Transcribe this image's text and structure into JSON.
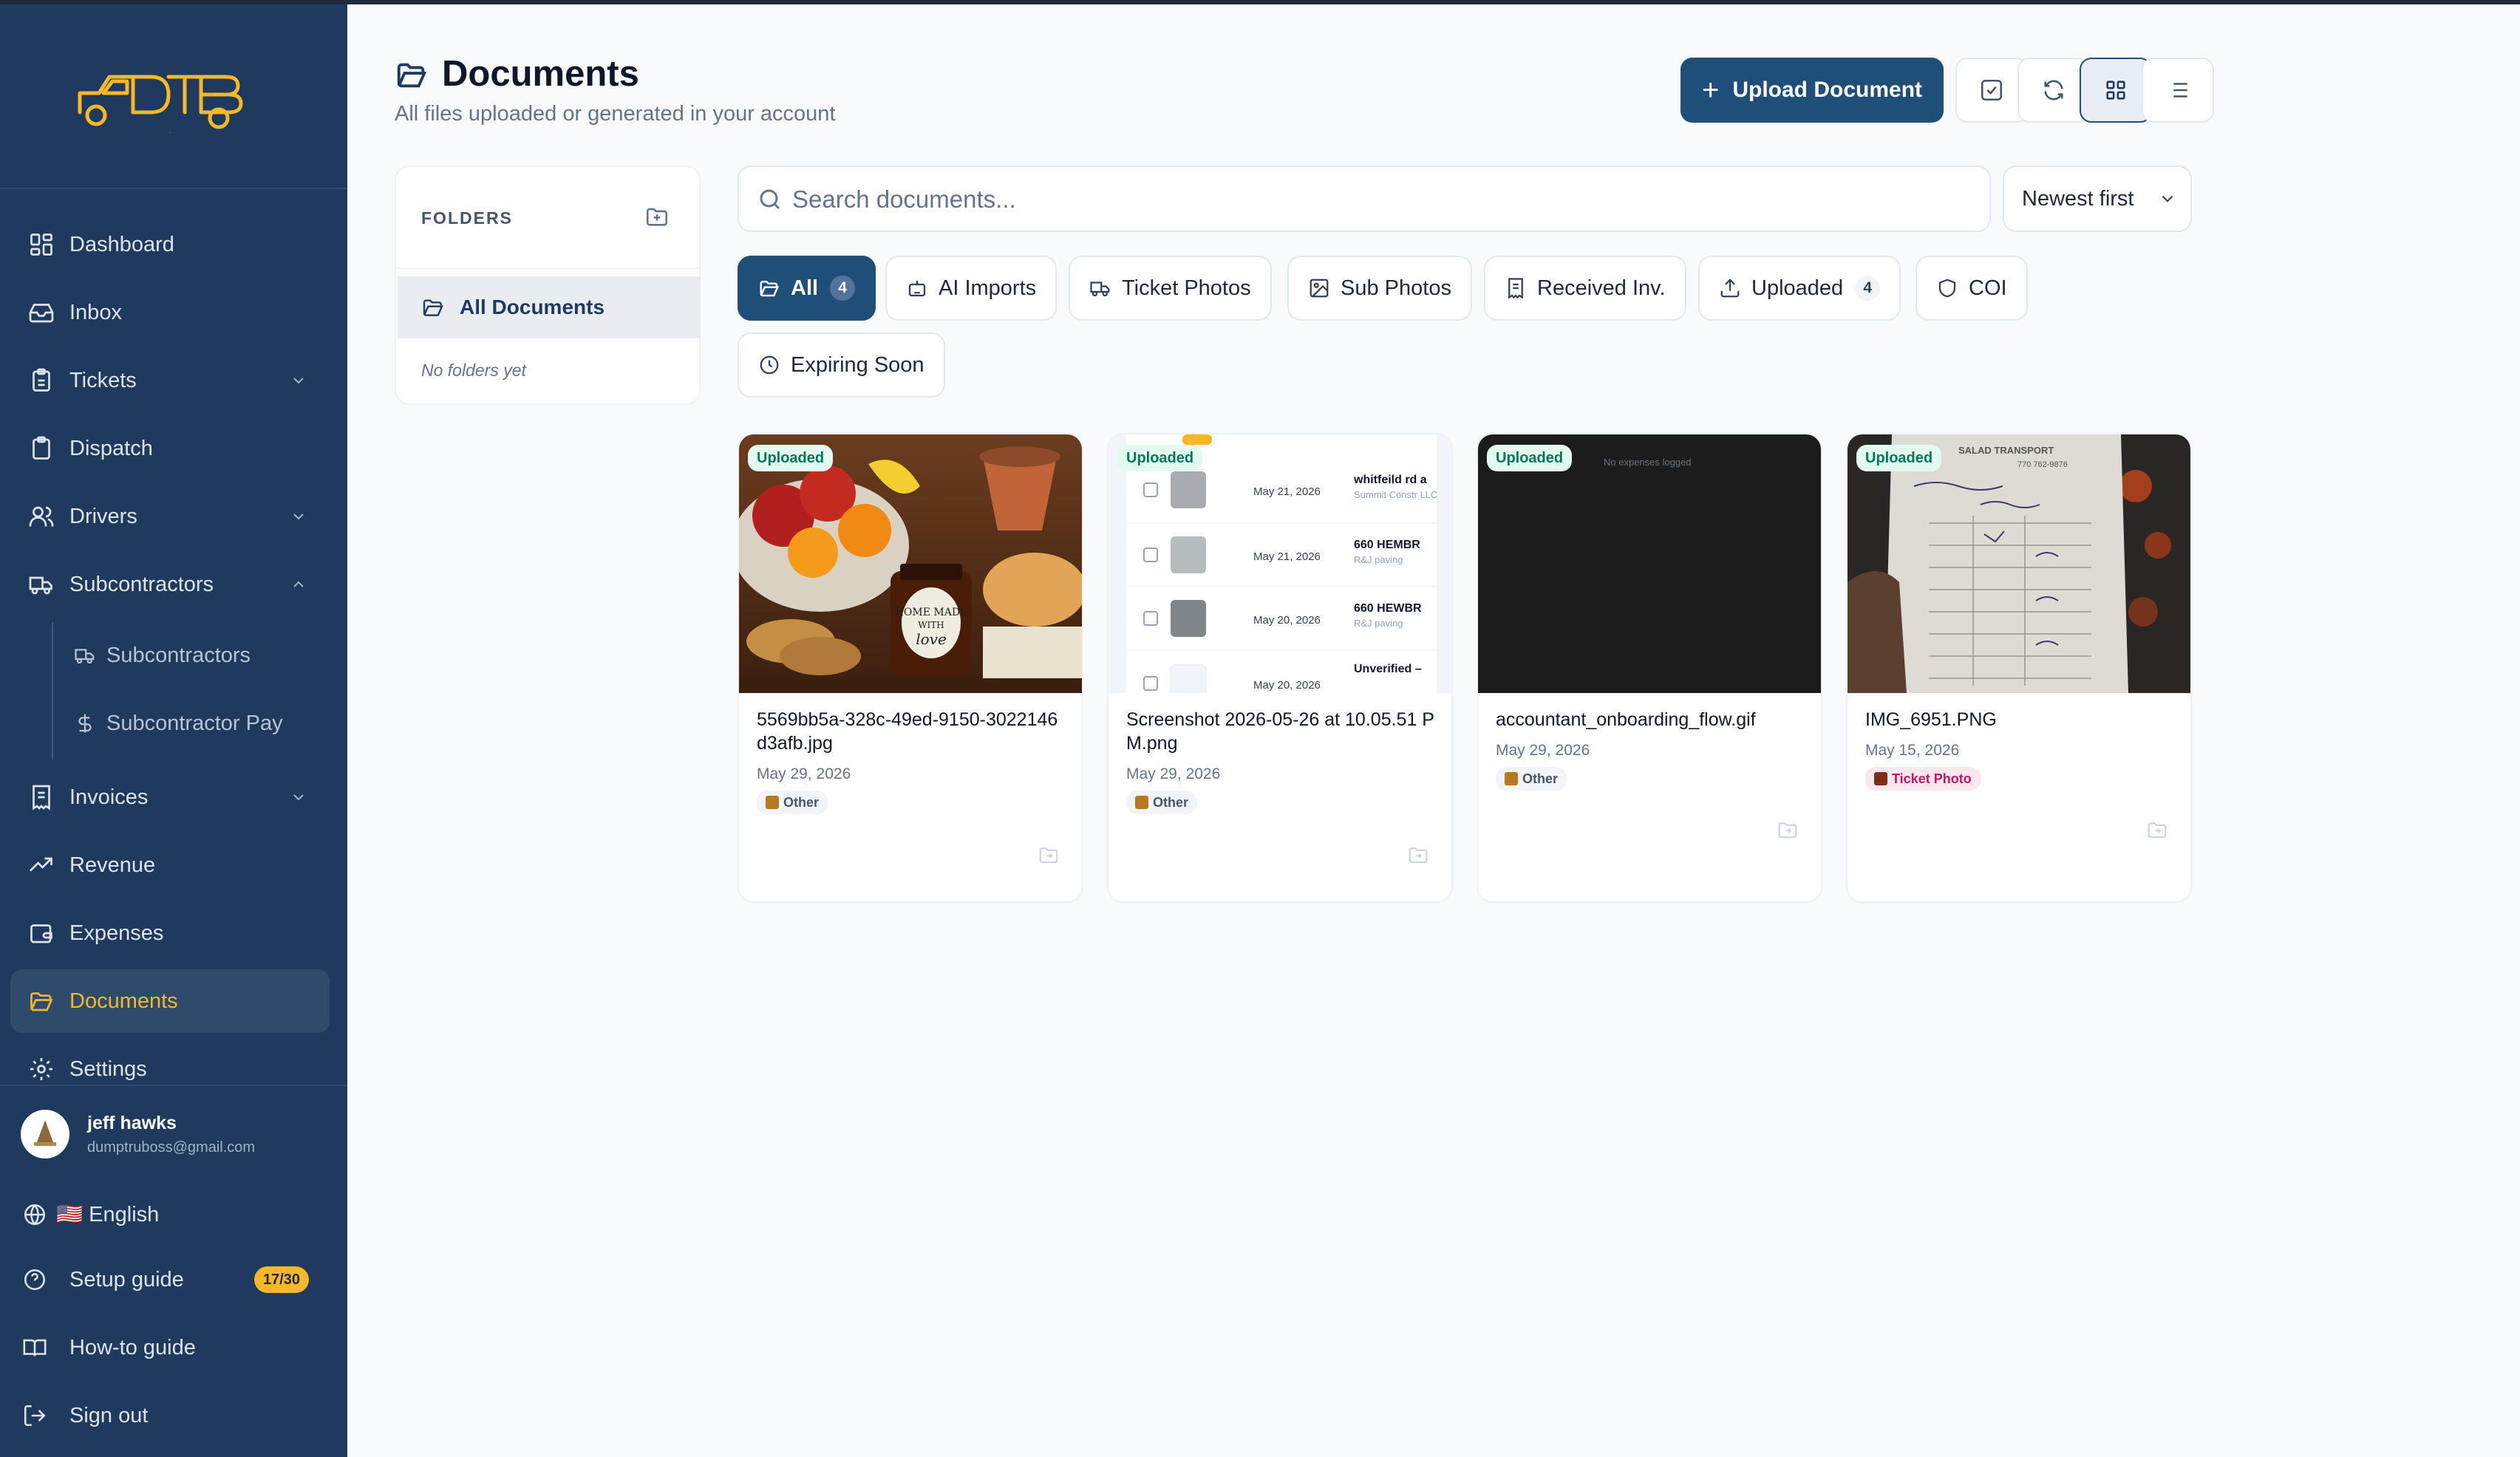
{
  "brand": {
    "logo_text": "DTB",
    "accent": "#f6b829",
    "primary": "#1f4e79",
    "sidebar_bg": "#1f3a5c"
  },
  "sidebar": {
    "items": [
      {
        "label": "Dashboard",
        "icon": "dashboard-icon"
      },
      {
        "label": "Inbox",
        "icon": "inbox-icon"
      },
      {
        "label": "Tickets",
        "icon": "clipboard-icon",
        "chevron": "down"
      },
      {
        "label": "Dispatch",
        "icon": "clipboard-icon"
      },
      {
        "label": "Drivers",
        "icon": "users-icon",
        "chevron": "down"
      },
      {
        "label": "Subcontractors",
        "icon": "truck-icon",
        "chevron": "up"
      },
      {
        "label": "Subcontractors",
        "icon": "truck-icon",
        "sub": true
      },
      {
        "label": "Subcontractor Pay",
        "icon": "dollar-icon",
        "sub": true
      },
      {
        "label": "Invoices",
        "icon": "receipt-icon",
        "chevron": "down"
      },
      {
        "label": "Revenue",
        "icon": "trend-up-icon"
      },
      {
        "label": "Expenses",
        "icon": "wallet-icon"
      },
      {
        "label": "Documents",
        "icon": "folder-open-icon",
        "active": true
      },
      {
        "label": "Settings",
        "icon": "gear-icon"
      }
    ],
    "user": {
      "name": "jeff hawks",
      "email": "dumptruboss@gmail.com"
    },
    "language": {
      "flag": "🇺🇸",
      "label": "English"
    },
    "setup_guide": {
      "label": "Setup guide",
      "badge": "17/30"
    },
    "how_to": "How-to guide",
    "sign_out": "Sign out"
  },
  "header": {
    "title": "Documents",
    "subtitle": "All files uploaded or generated in your account",
    "upload_label": "Upload Document"
  },
  "folders": {
    "heading": "FOLDERS",
    "all_label": "All Documents",
    "empty": "No folders yet"
  },
  "search": {
    "placeholder": "Search documents..."
  },
  "sort": {
    "selected": "Newest first"
  },
  "filters": [
    {
      "label": "All",
      "count": "4",
      "active": true,
      "icon": "folder-open-icon"
    },
    {
      "label": "AI Imports",
      "icon": "robot-icon"
    },
    {
      "label": "Ticket Photos",
      "icon": "truck-icon"
    },
    {
      "label": "Sub Photos",
      "icon": "image-icon"
    },
    {
      "label": "Received Inv.",
      "icon": "receipt-icon"
    },
    {
      "label": "Uploaded",
      "count": "4",
      "icon": "upload-icon"
    },
    {
      "label": "COI",
      "icon": "shield-icon"
    },
    {
      "label": "Expiring Soon",
      "icon": "clock-icon"
    }
  ],
  "documents": [
    {
      "badge": "Uploaded",
      "name": "5569bb5a-328c-49ed-9150-3022146d3afb.jpg",
      "date": "May 29, 2026",
      "tag": "Other",
      "tag_color": "#b7791f"
    },
    {
      "badge": "Uploaded",
      "name": "Screenshot 2026-05-26 at 10.05.51 PM.png",
      "date": "May 29, 2026",
      "tag": "Other",
      "tag_color": "#b7791f"
    },
    {
      "badge": "Uploaded",
      "name": "accountant_onboarding_flow.gif",
      "date": "May 29, 2026",
      "tag": "Other",
      "tag_color": "#b7791f"
    },
    {
      "badge": "Uploaded",
      "name": "IMG_6951.PNG",
      "date": "May 15, 2026",
      "tag": "Ticket Photo",
      "tag_color": "#be185d"
    }
  ],
  "screenshot_thumb": {
    "rows": [
      {
        "date": "May 21, 2026",
        "title": "whitfeild rd a",
        "company": "Summit Constr LLC"
      },
      {
        "date": "May 21, 2026",
        "title": "660 HEMBR",
        "company": "R&J paving"
      },
      {
        "date": "May 20, 2026",
        "title": "660 HEWBR",
        "company": "R&J paving"
      },
      {
        "date": "May 20, 2026",
        "title": "Unverified –",
        "company": ""
      }
    ]
  },
  "gif_thumb": {
    "text": "No expenses logged"
  },
  "receipt_thumb": {
    "header": "SALAD TRANSPORT",
    "phone": "770 762-9876"
  }
}
